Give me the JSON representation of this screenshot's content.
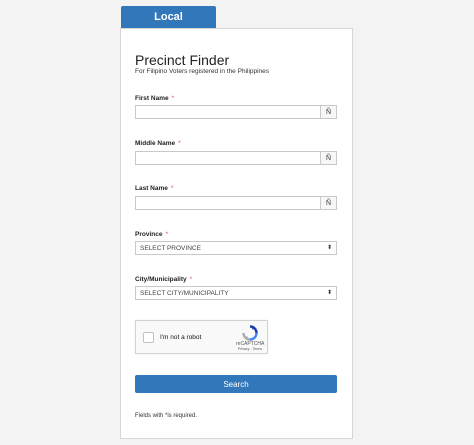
{
  "tab": {
    "label": "Local"
  },
  "form": {
    "title": "Precinct Finder",
    "subtitle": "For Filipino Voters registered in the Philippines",
    "required_mark": "*",
    "enye_button": "Ñ",
    "first_name": {
      "label": "First Name",
      "value": ""
    },
    "middle_name": {
      "label": "Middle Name",
      "value": ""
    },
    "last_name": {
      "label": "Last Name",
      "value": ""
    },
    "province": {
      "label": "Province",
      "selected": "SELECT PROVINCE"
    },
    "city": {
      "label": "City/Municipality",
      "selected": "SELECT CITY/MUNICIPALITY"
    },
    "captcha": {
      "checkbox_label": "I'm not a robot",
      "brand": "reCAPTCHA",
      "links": "Privacy - Terms"
    },
    "search_label": "Search",
    "required_note": "Fields with  *is required."
  },
  "colors": {
    "accent": "#3377bb",
    "required": "#d9534f",
    "background": "#f3f3f3"
  },
  "icons": {
    "caret": "up-down-caret-icon",
    "recaptcha": "recaptcha-logo-icon"
  }
}
